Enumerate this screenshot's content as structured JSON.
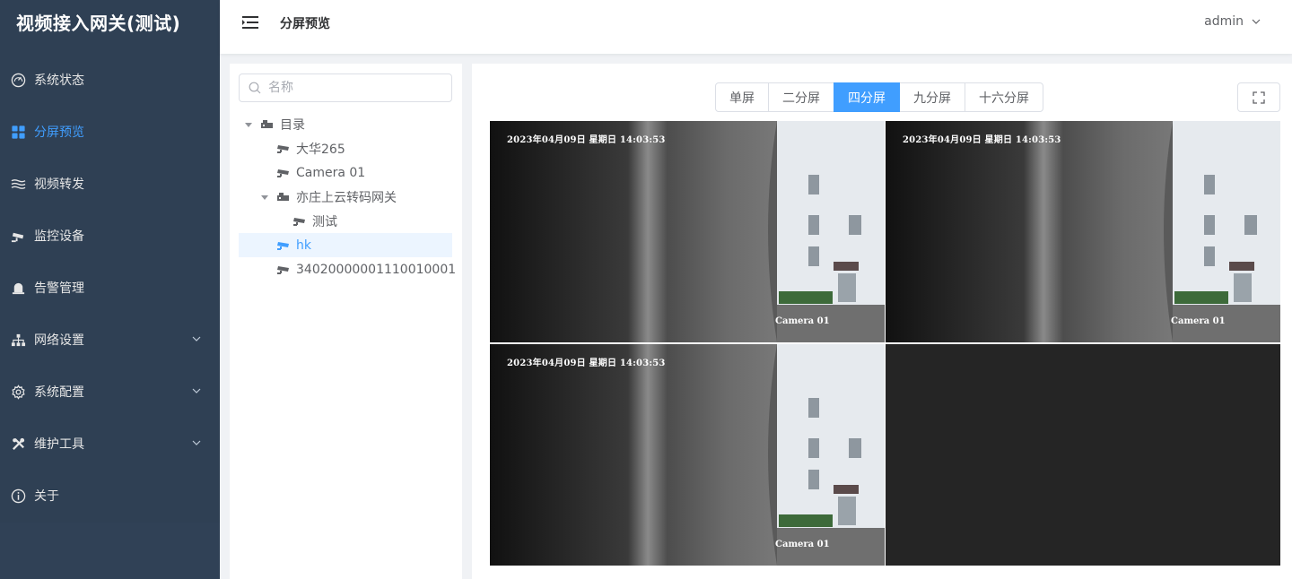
{
  "app": {
    "title": "视频接入网关(测试)"
  },
  "sidebar": {
    "items": [
      {
        "label": "系统状态",
        "icon": "dashboard-icon",
        "active": false,
        "expandable": false
      },
      {
        "label": "分屏预览",
        "icon": "grid-icon",
        "active": true,
        "expandable": false
      },
      {
        "label": "视频转发",
        "icon": "waves-icon",
        "active": false,
        "expandable": false
      },
      {
        "label": "监控设备",
        "icon": "camera-icon",
        "active": false,
        "expandable": false
      },
      {
        "label": "告警管理",
        "icon": "alarm-bell-icon",
        "active": false,
        "expandable": false
      },
      {
        "label": "网络设置",
        "icon": "network-icon",
        "active": false,
        "expandable": true
      },
      {
        "label": "系统配置",
        "icon": "gear-icon",
        "active": false,
        "expandable": true
      },
      {
        "label": "维护工具",
        "icon": "tools-icon",
        "active": false,
        "expandable": true
      },
      {
        "label": "关于",
        "icon": "info-icon",
        "active": false,
        "expandable": false
      }
    ]
  },
  "header": {
    "breadcrumb": "分屏预览",
    "user": "admin"
  },
  "tree": {
    "search_placeholder": "名称",
    "nodes": [
      {
        "label": "目录",
        "level": 0,
        "type": "folder",
        "expanded": true,
        "selected": false
      },
      {
        "label": "大华265",
        "level": 1,
        "type": "camera",
        "selected": false
      },
      {
        "label": "Camera 01",
        "level": 1,
        "type": "camera",
        "selected": false
      },
      {
        "label": "亦庄上云转码网关",
        "level": 1,
        "type": "folder",
        "expanded": true,
        "selected": false
      },
      {
        "label": "测试",
        "level": 2,
        "type": "camera",
        "selected": false
      },
      {
        "label": "hk",
        "level": 1,
        "type": "camera",
        "selected": true
      },
      {
        "label": "34020000001110010001",
        "level": 1,
        "type": "camera",
        "selected": false
      }
    ]
  },
  "layouts": {
    "options": [
      "单屏",
      "二分屏",
      "四分屏",
      "九分屏",
      "十六分屏"
    ],
    "active": "四分屏"
  },
  "cells": [
    {
      "timestamp": "2023年04月09日  星期日  14:03:53",
      "camera": "Camera 01",
      "has_video": true
    },
    {
      "timestamp": "2023年04月09日  星期日  14:03:53",
      "camera": "Camera 01",
      "has_video": true
    },
    {
      "timestamp": "2023年04月09日  星期日  14:03:53",
      "camera": "Camera 01",
      "has_video": true
    },
    {
      "timestamp": "",
      "camera": "",
      "has_video": false
    }
  ],
  "colors": {
    "sidebar_bg": "#2f4054",
    "accent": "#409eff",
    "menu_text": "#e6e6e6"
  }
}
